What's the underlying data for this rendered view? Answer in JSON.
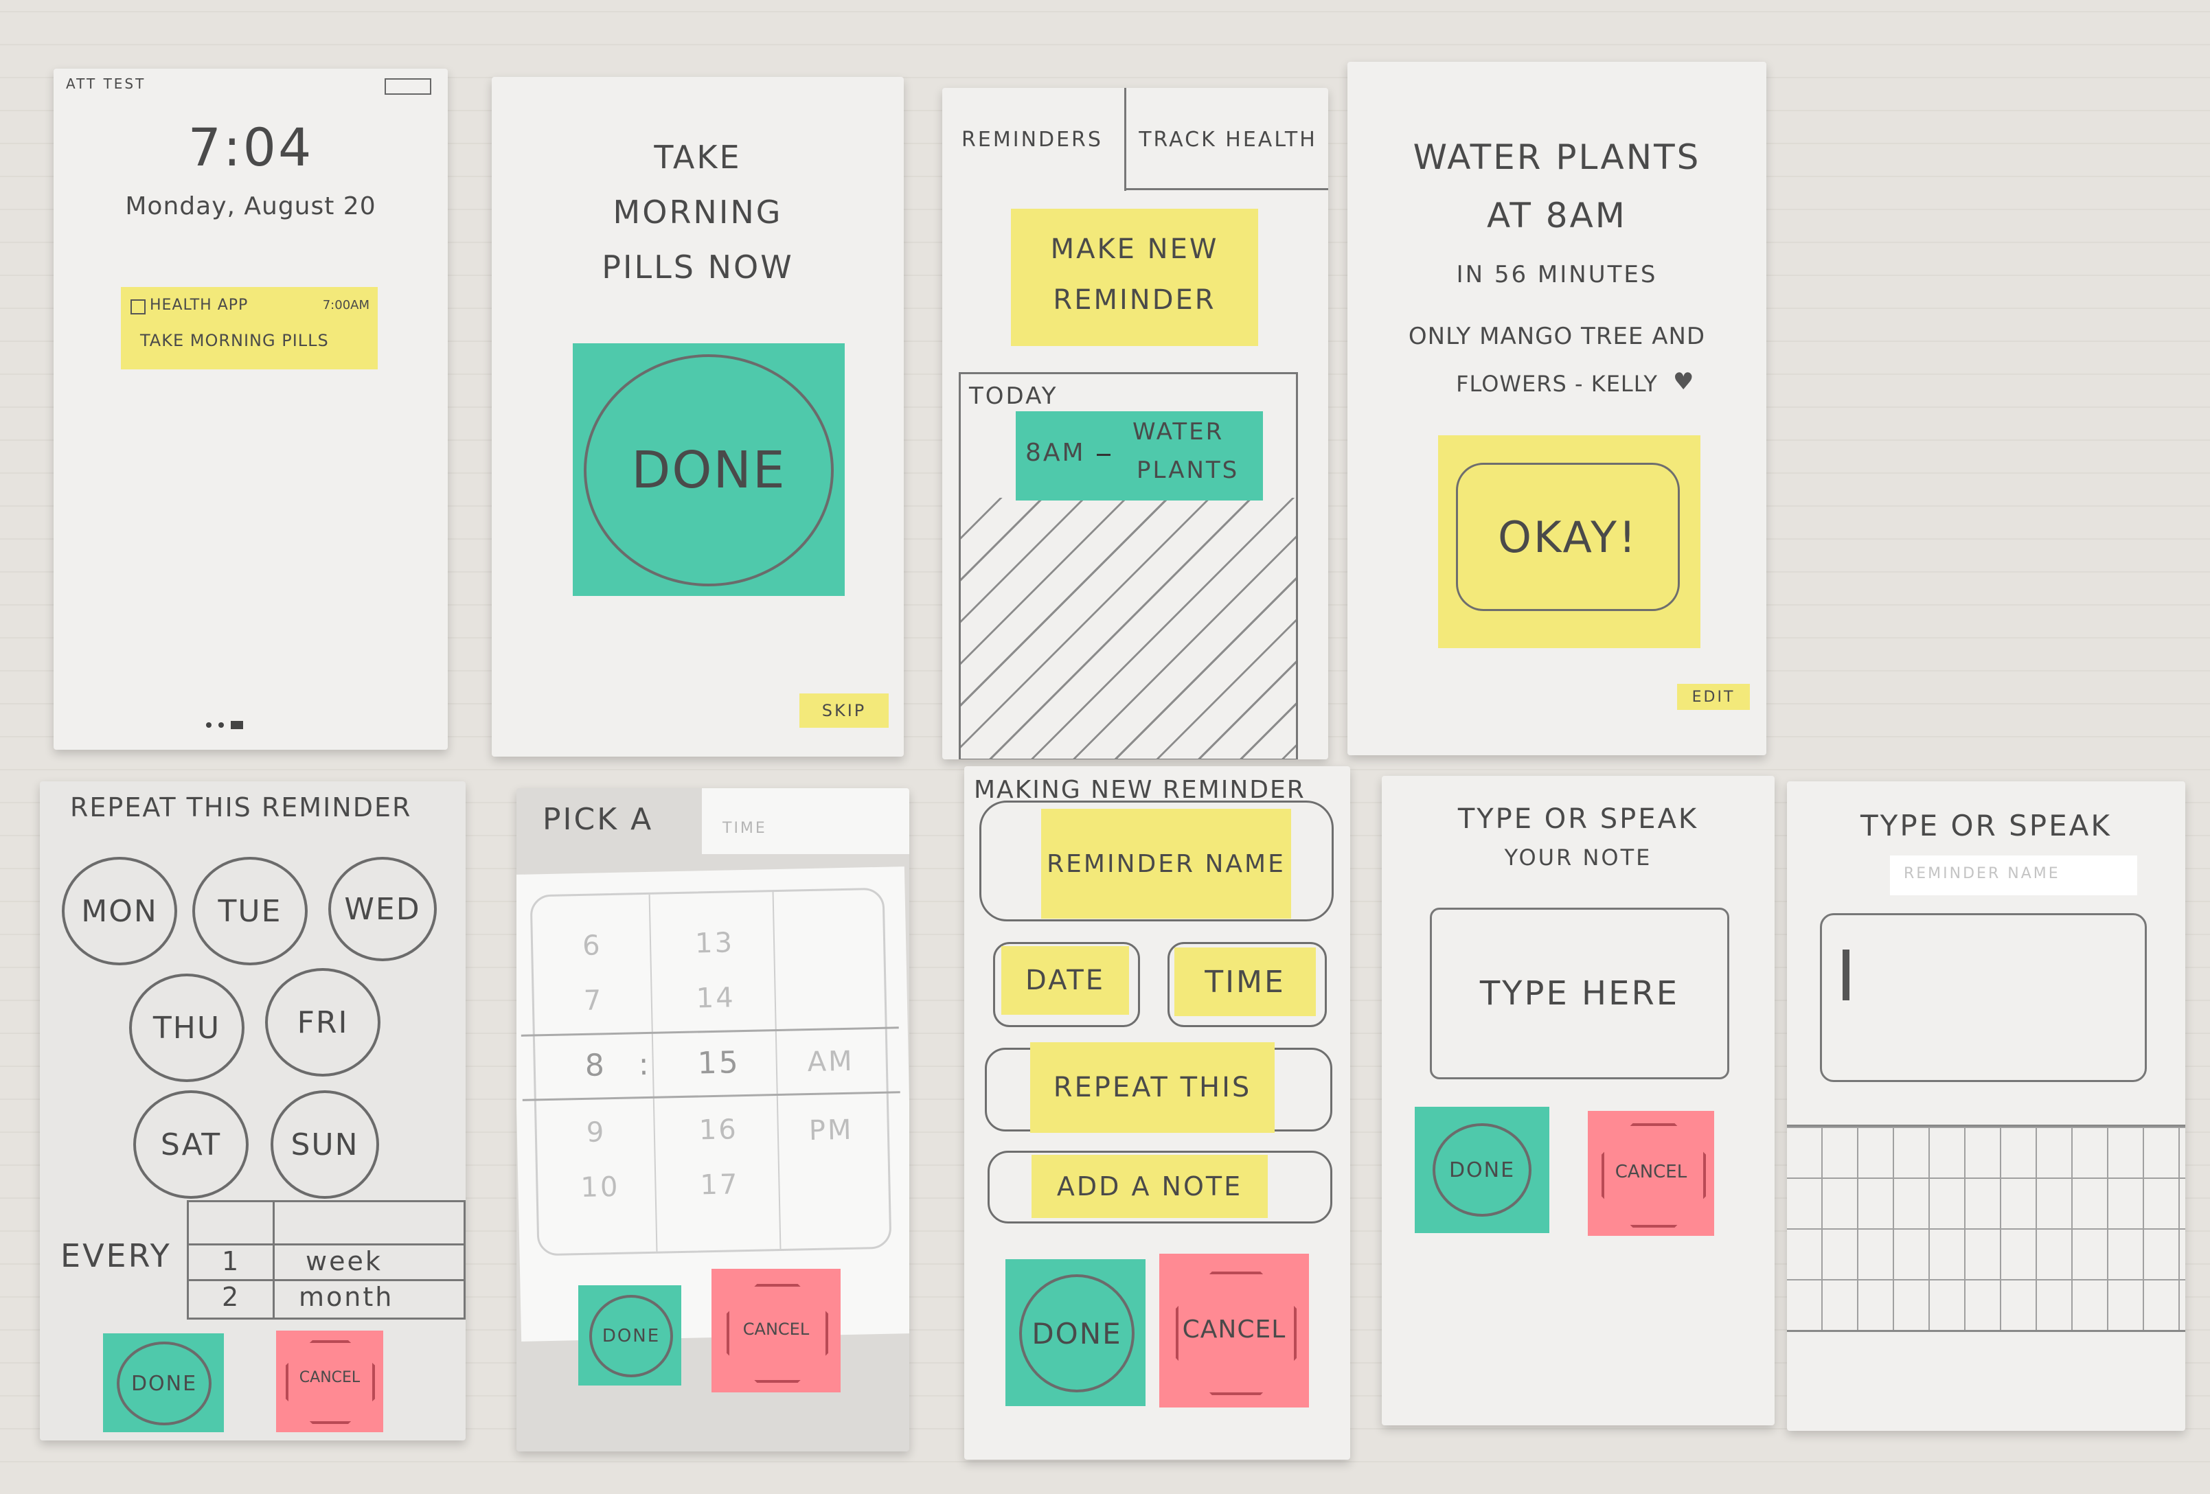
{
  "lock_screen": {
    "carrier": "ATT TEST",
    "time": "7:04",
    "date": "Monday, August 20",
    "notification": {
      "app": "HEALTH APP",
      "time": "7:00AM",
      "message": "TAKE MORNING PILLS"
    }
  },
  "pill_prompt": {
    "title_line1": "TAKE",
    "title_line2": "MORNING",
    "title_line3": "PILLS NOW",
    "done_label": "DONE",
    "skip_label": "SKIP"
  },
  "reminders_home": {
    "tabs": [
      "REMINDERS",
      "TRACK HEALTH"
    ],
    "make_new_line1": "MAKE NEW",
    "make_new_line2": "REMINDER",
    "today_label": "TODAY",
    "today_time": "8AM",
    "today_task_line1": "WATER",
    "today_task_line2": "PLANTS"
  },
  "reminder_alert": {
    "title_line1": "WATER PLANTS",
    "title_line2": "AT 8AM",
    "countdown": "IN 56 MINUTES",
    "note_line1": "ONLY MANGO TREE AND",
    "note_line2": "FLOWERS - KELLY",
    "okay_label": "OKAY!",
    "edit_label": "EDIT"
  },
  "repeat_screen": {
    "title": "REPEAT THIS REMINDER",
    "days": [
      "MON",
      "TUE",
      "WED",
      "THU",
      "FRI",
      "SAT",
      "SUN"
    ],
    "every_label": "EVERY",
    "picker_numbers": [
      "1",
      "2"
    ],
    "picker_units": [
      "week",
      "month"
    ],
    "done_label": "DONE",
    "cancel_label": "CANCEL"
  },
  "time_picker": {
    "title": "PICK A",
    "tab_label": "TIME",
    "hours": [
      "6",
      "7",
      "8",
      "9",
      "10"
    ],
    "minutes": [
      "13",
      "14",
      "15",
      "16",
      "17"
    ],
    "ampm": [
      "AM",
      "PM"
    ],
    "separator": ":",
    "done_label": "DONE",
    "cancel_label": "CANCEL"
  },
  "new_reminder": {
    "title": "MAKING NEW REMINDER",
    "name_label": "REMINDER NAME",
    "date_label": "DATE",
    "time_label": "TIME",
    "repeat_label": "REPEAT THIS",
    "note_label": "ADD A NOTE",
    "done_label": "DONE",
    "cancel_label": "CANCEL"
  },
  "note_screen": {
    "title_line1": "TYPE OR SPEAK",
    "title_line2": "YOUR NOTE",
    "input_placeholder": "TYPE HERE",
    "done_label": "DONE",
    "cancel_label": "CANCEL"
  },
  "keyboard_screen": {
    "title": "TYPE OR SPEAK",
    "tab_label": "REMINDER NAME"
  }
}
